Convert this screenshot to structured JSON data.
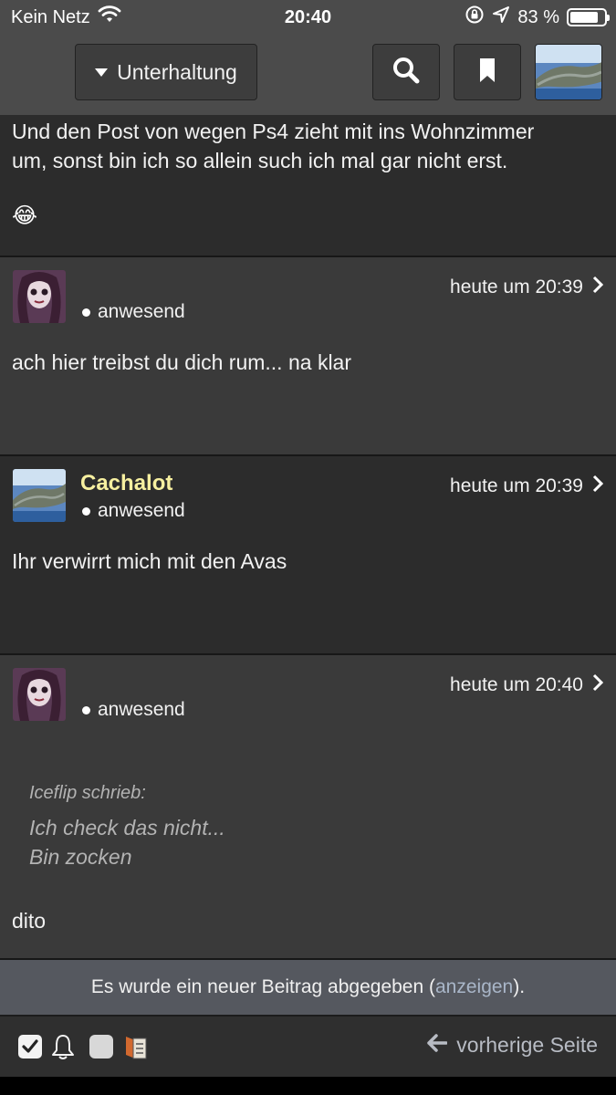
{
  "status_bar": {
    "carrier": "Kein Netz",
    "time": "20:40",
    "battery_text": "83 %",
    "battery_level": 0.83
  },
  "top_bar": {
    "forum_label": "Unterhaltung",
    "search_icon": "search-icon",
    "bookmark_icon": "bookmark-icon",
    "avatar_icon": "whale-avatar"
  },
  "posts": [
    {
      "body_line1": "Und den Post von wegen Ps4 zieht mit ins Wohnzimmer",
      "body_line2": "um, sonst bin ich so allein such ich mal gar nicht erst.",
      "emoji": "😂"
    },
    {
      "username": "",
      "status": "anwesend",
      "time": "heute um 20:39",
      "body": "ach hier treibst du dich rum... na klar"
    },
    {
      "username": "Cachalot",
      "username_color": "#f7f0a0",
      "status": "anwesend",
      "time": "heute um 20:39",
      "body": "Ihr verwirrt mich mit den Avas"
    },
    {
      "username": "",
      "status": "anwesend",
      "time": "heute um 20:40",
      "quote_author": "Iceflip schrieb:",
      "quote_line1": "Ich check das nicht...",
      "quote_line2": "Bin zocken",
      "body": "dito"
    }
  ],
  "notice": {
    "prefix": "Es wurde ein neuer Beitrag abgegeben (",
    "link": "anzeigen",
    "suffix": ")."
  },
  "bottom_bar": {
    "icons": [
      "checkbox-checked-icon",
      "bell-icon",
      "square-icon",
      "mark-read-icon"
    ],
    "prev_label": "vorherige Seite"
  }
}
